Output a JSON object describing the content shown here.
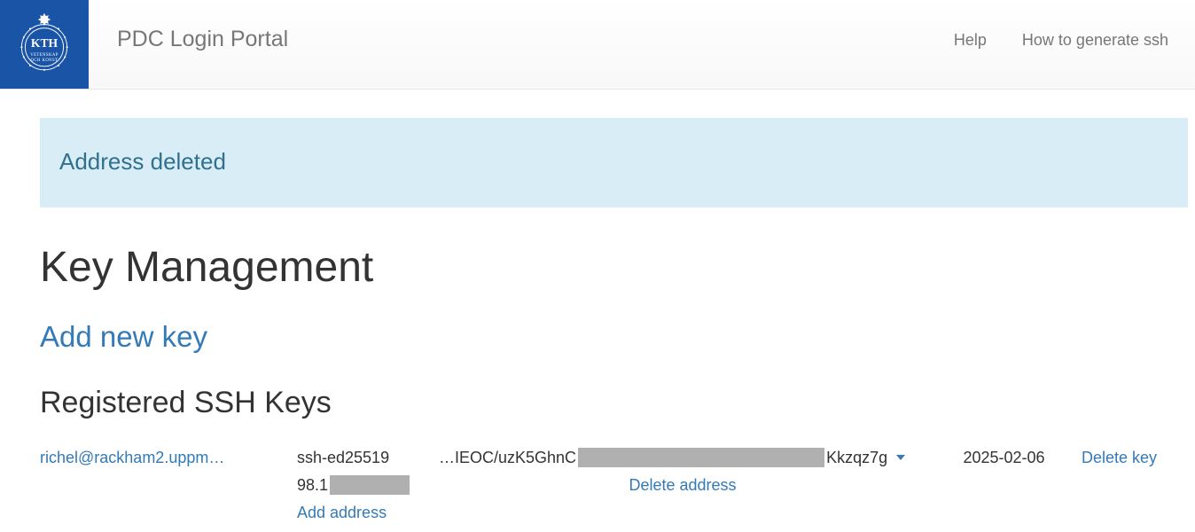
{
  "header": {
    "brand": "PDC Login Portal",
    "links": {
      "help": "Help",
      "howto": "How to generate ssh"
    }
  },
  "alert": {
    "message": "Address deleted"
  },
  "page": {
    "title": "Key Management",
    "add_new_key": "Add new key",
    "section_title": "Registered SSH Keys"
  },
  "keys": [
    {
      "label": "richel@rackham2.uppm…",
      "type": "ssh-ed25519",
      "fingerprint_prefix": "…IEOC/uzK5GhnC",
      "fingerprint_suffix": "Kkzqz7g",
      "date": "2025-02-06",
      "delete_key": "Delete key",
      "address_prefix": "98.1",
      "delete_address": "Delete address",
      "add_address": "Add address"
    }
  ]
}
